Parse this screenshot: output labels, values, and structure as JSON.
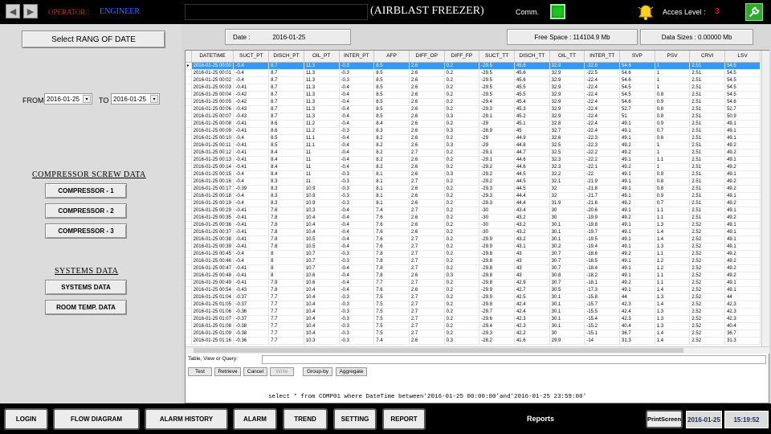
{
  "header": {
    "operator_label": "OPERATOR :",
    "operator_value": "ENGINEER",
    "title": "(AIRBLAST FREEZER)",
    "comm_label": "Comm.",
    "access_label": "Acces Level :",
    "access_value": "3"
  },
  "left": {
    "select_range": "Select RANG OF DATE",
    "from_label": "FROM",
    "to_label": "TO",
    "from_date": "2016-01-25",
    "to_date": "2016-01-25",
    "compressor_heading": "COMPRESSOR SCREW DATA",
    "compressors": [
      "COMPRESSOR - 1",
      "COMPRESSOR - 2",
      "COMPRESSOR - 3"
    ],
    "systems_heading": "SYSTEMS DATA",
    "systems_btn": "SYSTEMS DATA",
    "room_btn": "ROOM TEMP. DATA"
  },
  "status": {
    "date_label": "Date :",
    "date_value": "2016-01-25",
    "free_space": "Free Space  :  114104.9 Mb",
    "data_sizes": "Data Sizes :  0.00000 Mb"
  },
  "table": {
    "columns": [
      "DATETIME",
      "SUCT_PT",
      "DISCH_PT",
      "OIL_PT",
      "INTER_PT",
      "AFP",
      "DIFF_OP",
      "DIFF_FP",
      "SUCT_TT",
      "DISCH_TT",
      "OIL_TT",
      "INTER_TT",
      "SVP",
      "PSV",
      "CRVI",
      "LSV"
    ],
    "rows": [
      [
        "2016-01-25 00:00",
        "-0.4",
        "8.7",
        "11.3",
        "-0.3",
        "8.5",
        "2.6",
        "0.2",
        "-29.5",
        "45.6",
        "32.9",
        "-22.6",
        "54.6",
        "1",
        "2.51",
        "54.5"
      ],
      [
        "2016-01-25 00:01",
        "-0.4",
        "8.7",
        "11.3",
        "-0.3",
        "8.5",
        "2.6",
        "0.2",
        "-29.5",
        "45.6",
        "32.9",
        "-22.5",
        "54.6",
        "1",
        "2.51",
        "54.5"
      ],
      [
        "2016-01-25 00:02",
        "-0.4",
        "8.7",
        "11.3",
        "-0.3",
        "8.5",
        "2.6",
        "0.2",
        "-29.5",
        "45.6",
        "32.9",
        "-22.4",
        "54.6",
        "1",
        "2.51",
        "54.5"
      ],
      [
        "2016-01-25 00:03",
        "-0.41",
        "8.7",
        "11.3",
        "-0.4",
        "8.5",
        "2.6",
        "0.2",
        "-29.5",
        "45.5",
        "32.9",
        "-22.4",
        "54.5",
        "1",
        "2.51",
        "54.5"
      ],
      [
        "2016-01-25 00:04",
        "-0.42",
        "8.7",
        "11.3",
        "-0.4",
        "8.5",
        "2.6",
        "0.2",
        "-29.5",
        "45.5",
        "32.9",
        "-22.4",
        "54.5",
        "0.8",
        "2.51",
        "54.5"
      ],
      [
        "2016-01-25 00:05",
        "-0.42",
        "8.7",
        "11.3",
        "-0.4",
        "8.5",
        "2.6",
        "0.2",
        "-29.4",
        "45.4",
        "32.9",
        "-22.4",
        "54.6",
        "0.9",
        "2.51",
        "54.6"
      ],
      [
        "2016-01-25 00:06",
        "-0.43",
        "8.7",
        "11.3",
        "-0.4",
        "8.5",
        "2.6",
        "0.2",
        "-29.3",
        "45.3",
        "32.9",
        "-22.4",
        "52.7",
        "0.8",
        "2.51",
        "52.7"
      ],
      [
        "2016-01-25 00:07",
        "-0.43",
        "8.7",
        "11.3",
        "-0.4",
        "8.5",
        "2.6",
        "0.3",
        "-29.1",
        "45.2",
        "32.9",
        "-22.4",
        "51",
        "0.8",
        "2.51",
        "50.9"
      ],
      [
        "2016-01-25 00:08",
        "-0.41",
        "8.6",
        "11.2",
        "-0.4",
        "8.4",
        "2.6",
        "0.2",
        "-29",
        "45.1",
        "32.8",
        "-22.4",
        "49.1",
        "0.9",
        "2.51",
        "49.1"
      ],
      [
        "2016-01-25 00:09",
        "-0.41",
        "8.6",
        "11.2",
        "-0.3",
        "8.3",
        "2.6",
        "0.3",
        "-28.9",
        "45",
        "32.7",
        "-22.4",
        "49.1",
        "0.7",
        "2.51",
        "49.1"
      ],
      [
        "2016-01-25 00:10",
        "-0.4",
        "8.5",
        "11.1",
        "-0.4",
        "8.2",
        "2.6",
        "0.2",
        "-29",
        "44.9",
        "32.6",
        "-22.3",
        "49.1",
        "0.6",
        "2.51",
        "49.1"
      ],
      [
        "2016-01-25 00:11",
        "-0.41",
        "8.5",
        "11.1",
        "-0.4",
        "8.2",
        "2.6",
        "0.3",
        "-29",
        "44.8",
        "32.5",
        "-22.3",
        "49.2",
        "1",
        "2.51",
        "49.2"
      ],
      [
        "2016-01-25 00:12",
        "-0.41",
        "8.4",
        "11",
        "-0.4",
        "8.2",
        "2.7",
        "0.2",
        "-29.1",
        "44.7",
        "32.5",
        "-22.2",
        "49.2",
        "1",
        "2.51",
        "49.2"
      ],
      [
        "2016-01-25 00:13",
        "-0.41",
        "8.4",
        "11",
        "-0.4",
        "8.2",
        "2.6",
        "0.2",
        "-29.1",
        "44.6",
        "32.3",
        "-22.2",
        "49.1",
        "1.1",
        "2.51",
        "49.1"
      ],
      [
        "2016-01-25 00:14",
        "-0.41",
        "8.4",
        "11",
        "-0.4",
        "8.2",
        "2.6",
        "0.2",
        "-29.2",
        "44.6",
        "32.3",
        "-22.1",
        "49.2",
        "1",
        "2.51",
        "49.2"
      ],
      [
        "2016-01-25 00:15",
        "-0.4",
        "8.4",
        "11",
        "-0.3",
        "8.1",
        "2.6",
        "0.3",
        "-29.2",
        "44.5",
        "32.2",
        "-22",
        "49.1",
        "0.9",
        "2.51",
        "49.1"
      ],
      [
        "2016-01-25 00:16",
        "-0.4",
        "8.3",
        "11",
        "-0.3",
        "8.1",
        "2.7",
        "0.2",
        "-29.2",
        "44.5",
        "32.1",
        "-21.9",
        "49.1",
        "0.8",
        "2.51",
        "49.2"
      ],
      [
        "2016-01-25 00:17",
        "-0.39",
        "8.3",
        "10.9",
        "-0.3",
        "8.1",
        "2.6",
        "0.2",
        "-29.3",
        "44.5",
        "32",
        "-21.8",
        "49.1",
        "0.8",
        "2.51",
        "49.2"
      ],
      [
        "2016-01-25 00:18",
        "-0.4",
        "8.3",
        "10.9",
        "-0.3",
        "8.1",
        "2.6",
        "0.2",
        "-29.3",
        "44.4",
        "32",
        "-21.7",
        "49.1",
        "0.9",
        "2.51",
        "49.1"
      ],
      [
        "2016-01-25 00:19",
        "-0.4",
        "8.3",
        "10.9",
        "-0.3",
        "8.1",
        "2.6",
        "0.2",
        "-29.3",
        "44.4",
        "31.9",
        "-21.6",
        "49.2",
        "0.7",
        "2.51",
        "49.2"
      ],
      [
        "2016-01-25 00:29",
        "-0.41",
        "7.6",
        "10.3",
        "-0.4",
        "7.4",
        "2.7",
        "0.2",
        "-30",
        "43.4",
        "30",
        "-20.6",
        "49.1",
        "1.1",
        "2.51",
        "49.1"
      ],
      [
        "2016-01-25 00:35",
        "-0.41",
        "7.8",
        "10.4",
        "-0.4",
        "7.6",
        "2.6",
        "0.2",
        "-30",
        "43.2",
        "30",
        "-19.9",
        "49.2",
        "1.1",
        "2.51",
        "49.2"
      ],
      [
        "2016-01-25 00:36",
        "-0.41",
        "7.8",
        "10.4",
        "-0.4",
        "7.6",
        "2.6",
        "0.2",
        "-30",
        "43.2",
        "30.1",
        "-19.8",
        "49.1",
        "1.3",
        "2.52",
        "49.1"
      ],
      [
        "2016-01-25 00:37",
        "-0.41",
        "7.8",
        "10.4",
        "-0.4",
        "7.6",
        "2.6",
        "0.2",
        "-30",
        "43.2",
        "30.1",
        "-19.7",
        "49.1",
        "1.4",
        "2.52",
        "49.1"
      ],
      [
        "2016-01-25 00:38",
        "-0.41",
        "7.8",
        "10.5",
        "-0.4",
        "7.6",
        "2.7",
        "0.2",
        "-29.9",
        "43.2",
        "30.1",
        "-19.5",
        "49.1",
        "1.4",
        "2.52",
        "49.1"
      ],
      [
        "2016-01-25 00:39",
        "-0.41",
        "7.8",
        "10.5",
        "-0.4",
        "7.6",
        "2.7",
        "0.2",
        "-29.9",
        "43.1",
        "30.2",
        "-19.4",
        "49.1",
        "1.3",
        "2.52",
        "49.1"
      ],
      [
        "2016-01-25 00:45",
        "-0.4",
        "8",
        "10.7",
        "-0.3",
        "7.8",
        "2.7",
        "0.2",
        "-29.8",
        "43",
        "30.7",
        "-18.6",
        "49.2",
        "1.1",
        "2.52",
        "49.2"
      ],
      [
        "2016-01-25 00:46",
        "-0.4",
        "8",
        "10.7",
        "-0.3",
        "7.8",
        "2.7",
        "0.2",
        "-29.8",
        "43",
        "30.7",
        "-18.5",
        "49.1",
        "1.2",
        "2.52",
        "49.2"
      ],
      [
        "2016-01-25 00:47",
        "-0.41",
        "8",
        "10.7",
        "-0.4",
        "7.8",
        "2.7",
        "0.2",
        "-29.8",
        "43",
        "30.7",
        "-18.4",
        "49.1",
        "1.2",
        "2.52",
        "49.2"
      ],
      [
        "2016-01-25 00:48",
        "-0.41",
        "8",
        "10.6",
        "-0.4",
        "7.8",
        "2.6",
        "0.3",
        "-29.8",
        "43",
        "30.8",
        "-18.2",
        "49.1",
        "1.1",
        "2.52",
        "49.2"
      ],
      [
        "2016-01-25 00:49",
        "-0.41",
        "7.9",
        "10.6",
        "-0.4",
        "7.7",
        "2.7",
        "0.2",
        "-29.8",
        "42.9",
        "30.7",
        "-18.1",
        "49.2",
        "1.1",
        "2.52",
        "49.1"
      ],
      [
        "2016-01-25 00:54",
        "-0.43",
        "7.8",
        "10.4",
        "-0.4",
        "7.6",
        "2.6",
        "0.2",
        "-29.9",
        "42.7",
        "30.5",
        "-17.3",
        "49.1",
        "1.4",
        "2.52",
        "49.1"
      ],
      [
        "2016-01-25 01:04",
        "-0.37",
        "7.7",
        "10.4",
        "-0.3",
        "7.5",
        "2.7",
        "0.2",
        "-29.9",
        "42.5",
        "30.1",
        "-15.8",
        "44",
        "1.3",
        "2.52",
        "44"
      ],
      [
        "2016-01-25 01:05",
        "-0.37",
        "7.7",
        "10.4",
        "-0.3",
        "7.5",
        "2.7",
        "0.2",
        "-29.8",
        "42.4",
        "30.1",
        "-15.7",
        "42.3",
        "1.4",
        "2.52",
        "42.3"
      ],
      [
        "2016-01-25 01:06",
        "-0.36",
        "7.7",
        "10.4",
        "-0.3",
        "7.5",
        "2.7",
        "0.2",
        "-29.7",
        "42.4",
        "30.1",
        "-15.5",
        "42.4",
        "1.3",
        "2.52",
        "42.3"
      ],
      [
        "2016-01-25 01:07",
        "-0.37",
        "7.7",
        "10.4",
        "-0.3",
        "7.5",
        "2.7",
        "0.2",
        "-29.6",
        "42.3",
        "30.1",
        "-15.4",
        "42.3",
        "1.3",
        "2.52",
        "42.3"
      ],
      [
        "2016-01-25 01:08",
        "-0.38",
        "7.7",
        "10.4",
        "-0.3",
        "7.5",
        "2.7",
        "0.2",
        "-29.4",
        "42.3",
        "30.1",
        "-15.2",
        "40.4",
        "1.3",
        "2.52",
        "40.4"
      ],
      [
        "2016-01-25 01:09",
        "-0.38",
        "7.7",
        "10.4",
        "-0.3",
        "7.5",
        "2.7",
        "0.2",
        "-29.3",
        "42.2",
        "30",
        "-15.1",
        "36.7",
        "1.4",
        "2.52",
        "36.7"
      ],
      [
        "2016-01-25 01:16",
        "-0.36",
        "7.7",
        "10.3",
        "-0.3",
        "7.4",
        "2.6",
        "0.3",
        "-28.2",
        "41.6",
        "29.9",
        "-14",
        "31.3",
        "1.4",
        "2.52",
        "31.3"
      ]
    ],
    "selected_row": 0
  },
  "query": {
    "label": "Table, View or Query:",
    "buttons": [
      "Test",
      "Retrieve",
      "Cancel",
      "Write",
      "Group-by",
      "Aggregate"
    ],
    "sql": "select * from COMP01 where DateTime between'2016-01-25 00:00:00'and'2016-01-25 23:59:00'"
  },
  "bottom": {
    "buttons": [
      "LOGIN",
      "FLOW DIAGRAM",
      "ALARM HISTORY",
      "ALARM",
      "TREND",
      "SETTING",
      "REPORT"
    ],
    "page_label": "Reports",
    "print_label": "PrintScreen",
    "date": "2016-01-25",
    "time": "15:19:52"
  },
  "colors": {
    "selection": "#3399ff",
    "led": "#1fc41f",
    "access_value": "#ff3030"
  }
}
